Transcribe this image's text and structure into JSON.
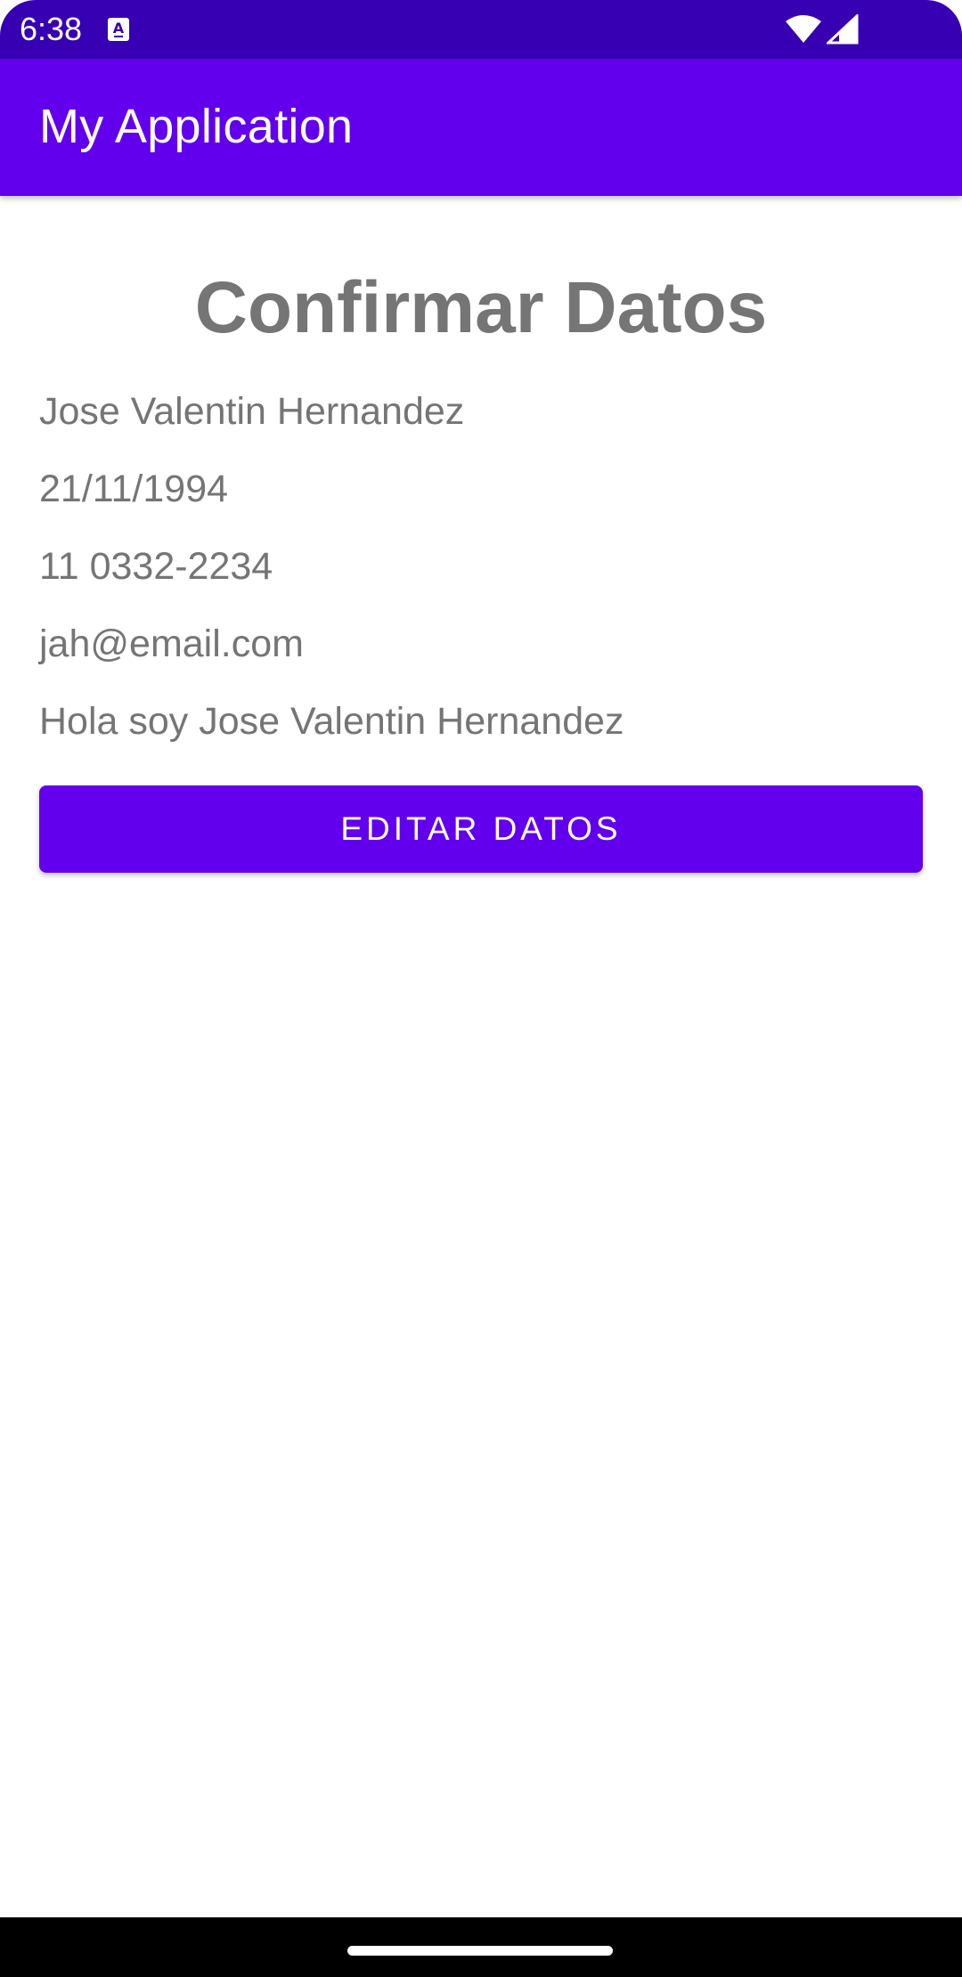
{
  "status_bar": {
    "time": "6:38",
    "notification_icon": "a-box-icon",
    "wifi_icon": "wifi-icon",
    "signal_icon": "signal-icon",
    "background_color": "#3700b3"
  },
  "app_bar": {
    "title": "My Application",
    "background_color": "#6200ee"
  },
  "main": {
    "title": "Confirmar Datos",
    "name": "Jose Valentin Hernandez",
    "birth_date": "21/11/1994",
    "phone": "11 0332-2234",
    "email": "jah@email.com",
    "description": "Hola soy Jose Valentin Hernandez",
    "edit_button_label": "EDITAR DATOS",
    "text_color": "#757575",
    "accent_color": "#6200ee"
  },
  "nav_bar": {
    "handle": "home-handle"
  }
}
